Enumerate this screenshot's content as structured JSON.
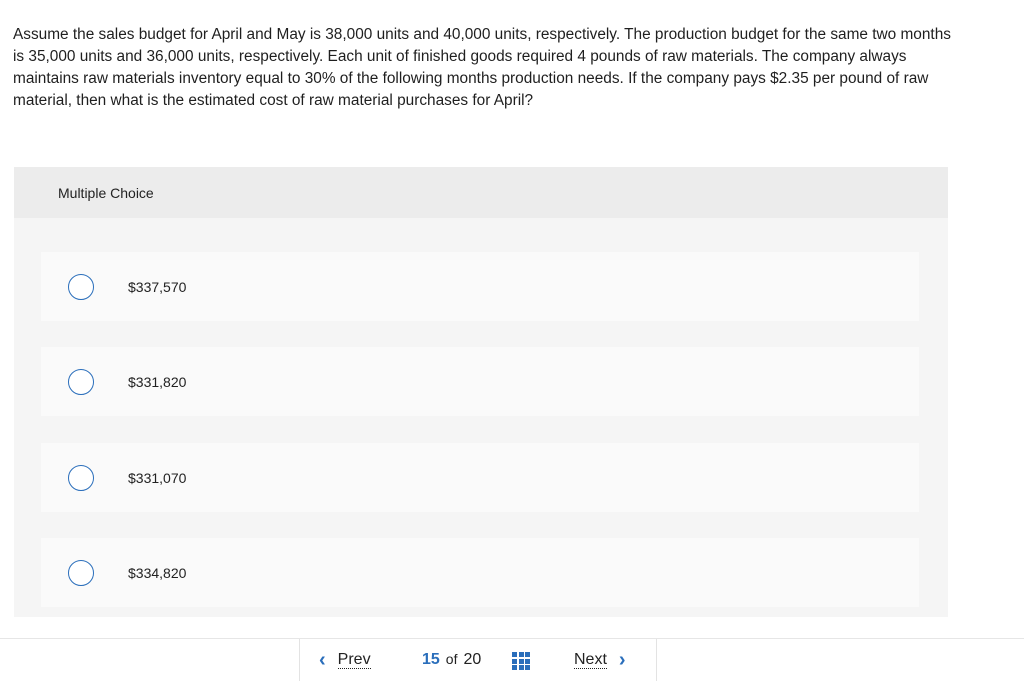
{
  "question": {
    "text": "Assume the sales budget for April and May is 38,000 units and 40,000 units, respectively. The production budget for the same two months is 35,000 units and 36,000 units, respectively. Each unit of finished goods required 4 pounds of raw materials. The company always maintains raw materials inventory equal to 30% of the following months production needs. If the company pays $2.35 per pound of raw material, then what is the estimated cost of raw material purchases for April?"
  },
  "multiple_choice": {
    "header": "Multiple Choice",
    "options": [
      {
        "label": "$337,570",
        "selected": false
      },
      {
        "label": "$331,820",
        "selected": false
      },
      {
        "label": "$331,070",
        "selected": false
      },
      {
        "label": "$334,820",
        "selected": false
      }
    ]
  },
  "footer": {
    "prev_label": "Prev",
    "next_label": "Next",
    "current_page": "15",
    "of_label": "of",
    "total_pages": "20",
    "grid_icon": "grid-icon"
  },
  "colors": {
    "accent": "#2a6ebb",
    "panel_bg": "#f5f5f5",
    "header_bg": "#ececec"
  }
}
